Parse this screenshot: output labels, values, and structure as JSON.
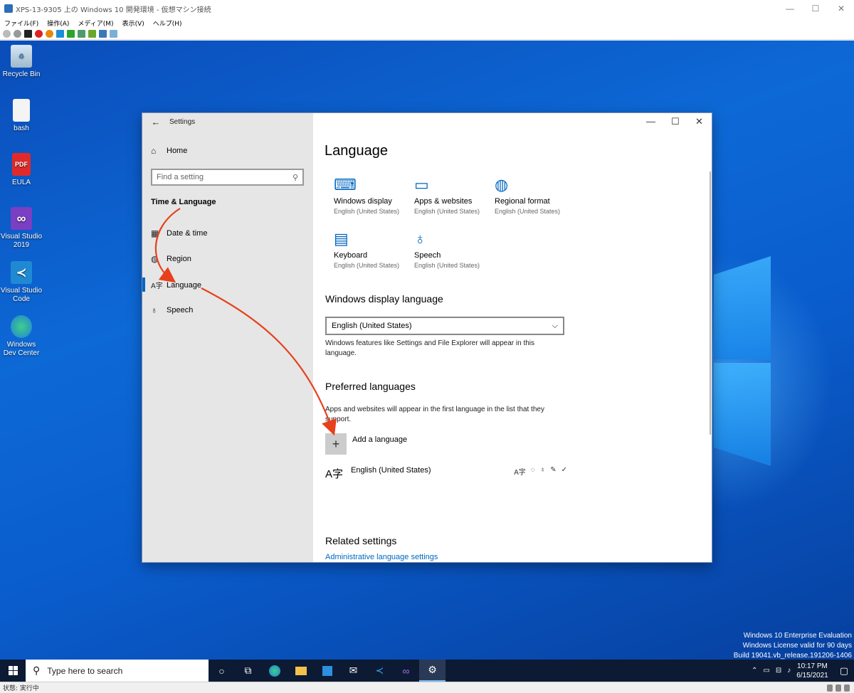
{
  "vm": {
    "title": "XPS-13-9305 上の Windows 10 開発環境 - 仮想マシン接続",
    "menu": [
      "ファイル(F)",
      "操作(A)",
      "メディア(M)",
      "表示(V)",
      "ヘルプ(H)"
    ],
    "status": "状態: 実行中"
  },
  "desktop": {
    "icons": [
      {
        "label": "Recycle Bin"
      },
      {
        "label": "bash"
      },
      {
        "label": "EULA",
        "glyph": "PDF"
      },
      {
        "label": "Visual Studio 2019"
      },
      {
        "label": "Visual Studio Code"
      },
      {
        "label": "Windows Dev Center"
      }
    ],
    "watermark": [
      "Windows 10 Enterprise Evaluation",
      "Windows License valid for 90 days",
      "Build 19041.vb_release.191206-1406"
    ]
  },
  "taskbar": {
    "search_placeholder": "Type here to search",
    "time": "10:17 PM",
    "date": "6/15/2021"
  },
  "settings": {
    "window_title": "Settings",
    "home": "Home",
    "search_placeholder": "Find a setting",
    "section": "Time & Language",
    "nav": [
      {
        "label": "Date & time"
      },
      {
        "label": "Region"
      },
      {
        "label": "Language",
        "selected": true
      },
      {
        "label": "Speech"
      }
    ],
    "page_title": "Language",
    "tiles": [
      {
        "name": "Windows display",
        "sub": "English (United States)",
        "icon": "laptop-icon"
      },
      {
        "name": "Apps & websites",
        "sub": "English (United States)",
        "icon": "window-icon"
      },
      {
        "name": "Regional format",
        "sub": "English (United States)",
        "icon": "globe-icon"
      },
      {
        "name": "Keyboard",
        "sub": "English (United States)",
        "icon": "keyboard-icon"
      },
      {
        "name": "Speech",
        "sub": "English (United States)",
        "icon": "microphone-icon"
      }
    ],
    "display_language": {
      "heading": "Windows display language",
      "selected": "English (United States)",
      "desc": "Windows features like Settings and File Explorer will appear in this language."
    },
    "preferred": {
      "heading": "Preferred languages",
      "desc": "Apps and websites will appear in the first language in the list that they support.",
      "add_label": "Add a language",
      "languages": [
        {
          "name": "English (United States)"
        }
      ]
    },
    "related": {
      "heading": "Related settings",
      "link": "Administrative language settings"
    }
  },
  "colors": {
    "accent": "#0067c0",
    "annotation": "#e8401c"
  }
}
